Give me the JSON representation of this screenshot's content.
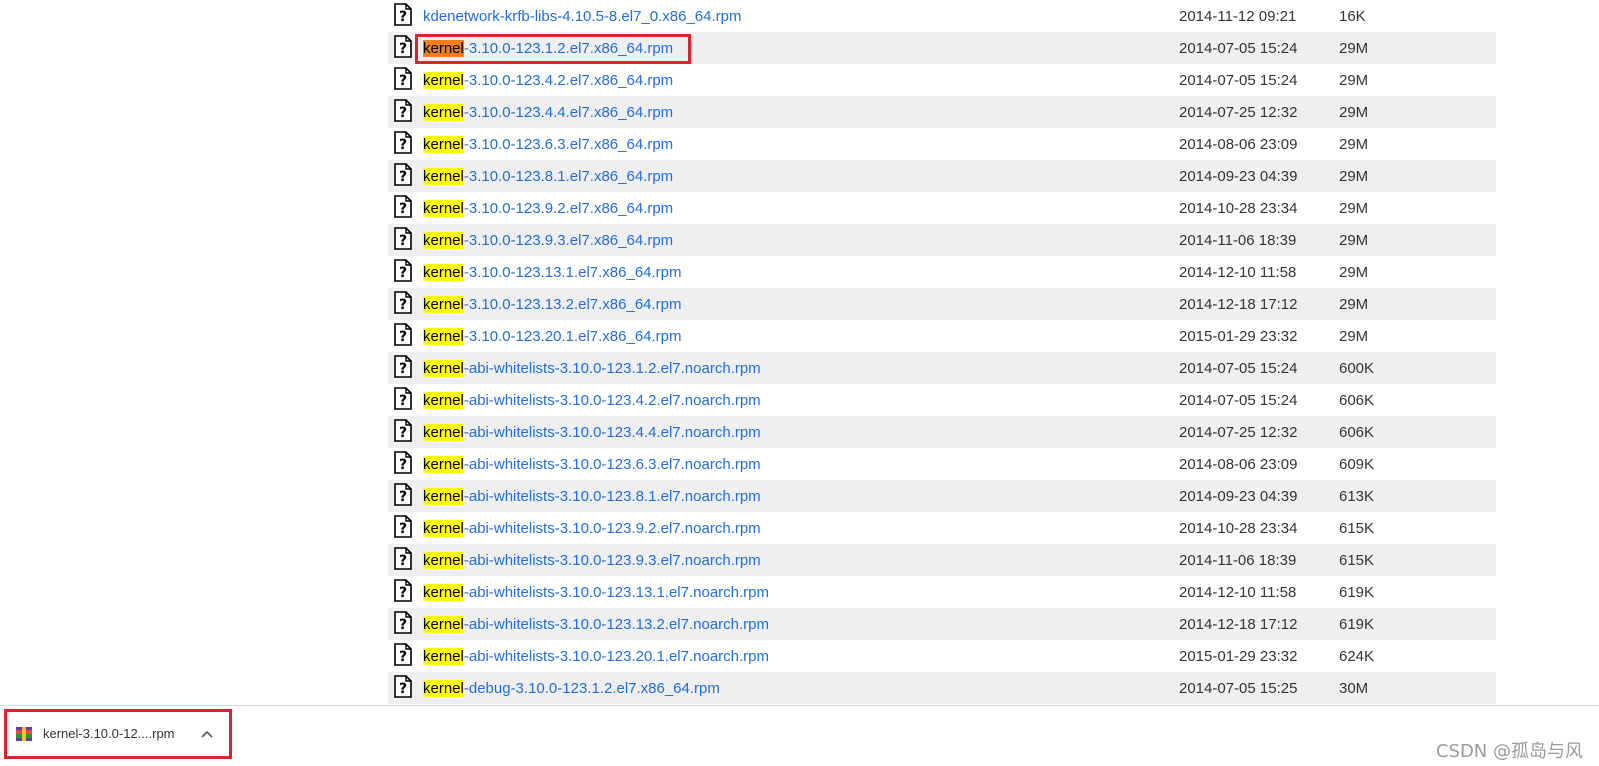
{
  "files": [
    {
      "prefix": "",
      "rest": "kdenetwork-krfb-libs-4.10.5-8.el7_0.x86_64.rpm",
      "date": "2014-11-12 09:21",
      "size": "16K"
    },
    {
      "prefix": "kernel",
      "rest": "-3.10.0-123.1.2.el7.x86_64.rpm",
      "date": "2014-07-05 15:24",
      "size": "29M",
      "current": true
    },
    {
      "prefix": "kernel",
      "rest": "-3.10.0-123.4.2.el7.x86_64.rpm",
      "date": "2014-07-05 15:24",
      "size": "29M"
    },
    {
      "prefix": "kernel",
      "rest": "-3.10.0-123.4.4.el7.x86_64.rpm",
      "date": "2014-07-25 12:32",
      "size": "29M"
    },
    {
      "prefix": "kernel",
      "rest": "-3.10.0-123.6.3.el7.x86_64.rpm",
      "date": "2014-08-06 23:09",
      "size": "29M"
    },
    {
      "prefix": "kernel",
      "rest": "-3.10.0-123.8.1.el7.x86_64.rpm",
      "date": "2014-09-23 04:39",
      "size": "29M"
    },
    {
      "prefix": "kernel",
      "rest": "-3.10.0-123.9.2.el7.x86_64.rpm",
      "date": "2014-10-28 23:34",
      "size": "29M"
    },
    {
      "prefix": "kernel",
      "rest": "-3.10.0-123.9.3.el7.x86_64.rpm",
      "date": "2014-11-06 18:39",
      "size": "29M"
    },
    {
      "prefix": "kernel",
      "rest": "-3.10.0-123.13.1.el7.x86_64.rpm",
      "date": "2014-12-10 11:58",
      "size": "29M"
    },
    {
      "prefix": "kernel",
      "rest": "-3.10.0-123.13.2.el7.x86_64.rpm",
      "date": "2014-12-18 17:12",
      "size": "29M"
    },
    {
      "prefix": "kernel",
      "rest": "-3.10.0-123.20.1.el7.x86_64.rpm",
      "date": "2015-01-29 23:32",
      "size": "29M"
    },
    {
      "prefix": "kernel",
      "rest": "-abi-whitelists-3.10.0-123.1.2.el7.noarch.rpm",
      "date": "2014-07-05 15:24",
      "size": "600K"
    },
    {
      "prefix": "kernel",
      "rest": "-abi-whitelists-3.10.0-123.4.2.el7.noarch.rpm",
      "date": "2014-07-05 15:24",
      "size": "606K"
    },
    {
      "prefix": "kernel",
      "rest": "-abi-whitelists-3.10.0-123.4.4.el7.noarch.rpm",
      "date": "2014-07-25 12:32",
      "size": "606K"
    },
    {
      "prefix": "kernel",
      "rest": "-abi-whitelists-3.10.0-123.6.3.el7.noarch.rpm",
      "date": "2014-08-06 23:09",
      "size": "609K"
    },
    {
      "prefix": "kernel",
      "rest": "-abi-whitelists-3.10.0-123.8.1.el7.noarch.rpm",
      "date": "2014-09-23 04:39",
      "size": "613K"
    },
    {
      "prefix": "kernel",
      "rest": "-abi-whitelists-3.10.0-123.9.2.el7.noarch.rpm",
      "date": "2014-10-28 23:34",
      "size": "615K"
    },
    {
      "prefix": "kernel",
      "rest": "-abi-whitelists-3.10.0-123.9.3.el7.noarch.rpm",
      "date": "2014-11-06 18:39",
      "size": "615K"
    },
    {
      "prefix": "kernel",
      "rest": "-abi-whitelists-3.10.0-123.13.1.el7.noarch.rpm",
      "date": "2014-12-10 11:58",
      "size": "619K"
    },
    {
      "prefix": "kernel",
      "rest": "-abi-whitelists-3.10.0-123.13.2.el7.noarch.rpm",
      "date": "2014-12-18 17:12",
      "size": "619K"
    },
    {
      "prefix": "kernel",
      "rest": "-abi-whitelists-3.10.0-123.20.1.el7.noarch.rpm",
      "date": "2015-01-29 23:32",
      "size": "624K"
    },
    {
      "prefix": "kernel",
      "rest": "-debug-3.10.0-123.1.2.el7.x86_64.rpm",
      "date": "2014-07-05 15:25",
      "size": "30M"
    }
  ],
  "download": {
    "name": "kernel-3.10.0-12....rpm",
    "icon": "archive-file-icon"
  },
  "watermark": "CSDN @孤岛与风",
  "colors": {
    "link": "#1e6fd6",
    "highlight": "#ffff00",
    "current_highlight": "#f07e1a",
    "annotation_box": "#e0202a"
  }
}
